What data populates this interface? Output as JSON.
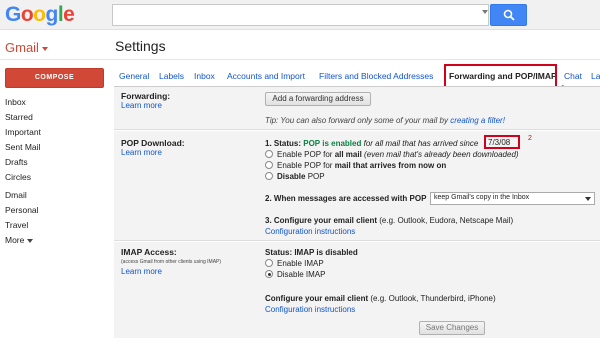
{
  "header": {
    "logo_letters": [
      "G",
      "o",
      "o",
      "g",
      "l",
      "e"
    ],
    "logo_colors": [
      "#4285f4",
      "#ea4335",
      "#fbbc05",
      "#4285f4",
      "#34a853",
      "#ea4335"
    ],
    "search_value": "",
    "search_icon": "magnifier-icon",
    "accent": "#4285f4"
  },
  "app_label": "Gmail",
  "page_title": "Settings",
  "compose_label": "COMPOSE",
  "sidebar": {
    "items": [
      "Inbox",
      "Starred",
      "Important",
      "Sent Mail",
      "Drafts",
      "Circles",
      "Dmail",
      "Personal",
      "Travel",
      "More"
    ]
  },
  "tabs": [
    {
      "label": "General"
    },
    {
      "label": "Labels"
    },
    {
      "label": "Inbox"
    },
    {
      "label": "Accounts and Import"
    },
    {
      "label": "Filters and Blocked Addresses"
    },
    {
      "label": "Forwarding and POP/IMAP",
      "active": true
    },
    {
      "label": "Chat"
    },
    {
      "label": "La"
    }
  ],
  "annotations": {
    "one": "1",
    "two": "2",
    "color": "#d0021b"
  },
  "forwarding": {
    "label": "Forwarding:",
    "learn_more": "Learn more",
    "add_button": "Add a forwarding address",
    "tip_prefix": "Tip: You can also forward only some of your mail by",
    "tip_link": "creating a filter!"
  },
  "pop": {
    "label": "POP Download:",
    "learn_more": "Learn more",
    "status_prefix": "1. Status:",
    "status_value": "POP is enabled",
    "status_suffix": "for all mail that has arrived since",
    "since_date": "7/3/08",
    "options": [
      {
        "pre": "Enable POP for",
        "bold": "all mail",
        "post": "(even mail that's already been downloaded)",
        "selected": false
      },
      {
        "pre": "Enable POP for",
        "bold": "mail that arrives from now on",
        "post": "",
        "selected": false
      },
      {
        "pre": "",
        "bold": "Disable",
        "post": "POP",
        "selected": false
      }
    ],
    "when_accessed": "2. When messages are accessed with POP",
    "when_selected": "keep Gmail's copy in the Inbox",
    "configure_label": "3. Configure your email client",
    "configure_note": "(e.g. Outlook, Eudora, Netscape Mail)",
    "configure_link": "Configuration instructions"
  },
  "imap": {
    "label": "IMAP Access:",
    "note": "(access Gmail from other clients using IMAP)",
    "learn_more": "Learn more",
    "status": "Status: IMAP is disabled",
    "options": [
      {
        "label": "Enable IMAP",
        "selected": false
      },
      {
        "label": "Disable IMAP",
        "selected": true
      }
    ],
    "configure_label": "Configure your email client",
    "configure_note": "(e.g. Outlook, Thunderbird, iPhone)",
    "configure_link": "Configuration instructions"
  },
  "save_button": "Save Changes"
}
